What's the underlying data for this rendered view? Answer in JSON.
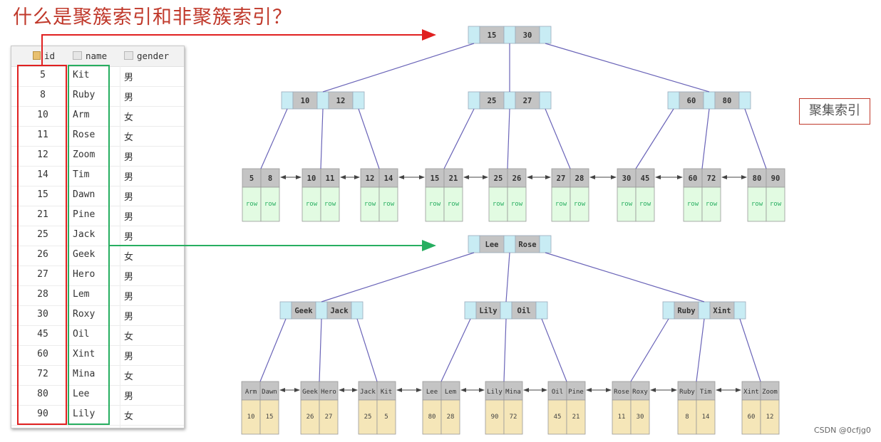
{
  "title": "什么是聚簇索引和非聚簇索引？",
  "table": {
    "columns": [
      {
        "label": "id",
        "icon": "primary-key-column-icon"
      },
      {
        "label": "name",
        "icon": "column-icon"
      },
      {
        "label": "gender",
        "icon": "column-icon"
      }
    ],
    "rows": [
      {
        "id": "5",
        "name": "Kit",
        "gender": "男"
      },
      {
        "id": "8",
        "name": "Ruby",
        "gender": "男"
      },
      {
        "id": "10",
        "name": "Arm",
        "gender": "女"
      },
      {
        "id": "11",
        "name": "Rose",
        "gender": "女"
      },
      {
        "id": "12",
        "name": "Zoom",
        "gender": "男"
      },
      {
        "id": "14",
        "name": "Tim",
        "gender": "男"
      },
      {
        "id": "15",
        "name": "Dawn",
        "gender": "男"
      },
      {
        "id": "21",
        "name": "Pine",
        "gender": "男"
      },
      {
        "id": "25",
        "name": "Jack",
        "gender": "男"
      },
      {
        "id": "26",
        "name": "Geek",
        "gender": "女"
      },
      {
        "id": "27",
        "name": "Hero",
        "gender": "男"
      },
      {
        "id": "28",
        "name": "Lem",
        "gender": "男"
      },
      {
        "id": "30",
        "name": "Roxy",
        "gender": "男"
      },
      {
        "id": "45",
        "name": "Oil",
        "gender": "女"
      },
      {
        "id": "60",
        "name": "Xint",
        "gender": "男"
      },
      {
        "id": "72",
        "name": "Mina",
        "gender": "女"
      },
      {
        "id": "80",
        "name": "Lee",
        "gender": "男"
      },
      {
        "id": "90",
        "name": "Lily",
        "gender": "女"
      }
    ]
  },
  "clustered_label": "聚集索引",
  "colors": {
    "title": "#c0392b",
    "id_highlight": "#e02020",
    "name_highlight": "#27ae60",
    "pointer_cell": "#c8ecf4",
    "key_cell": "#c4c4c4",
    "row_leaf": "#e2fbe2",
    "value_leaf": "#f5e6b8",
    "edge": "#6a64b8"
  },
  "clustered_tree": {
    "root": [
      "15",
      "30"
    ],
    "internal": [
      [
        "10",
        "12"
      ],
      [
        "25",
        "27"
      ],
      [
        "60",
        "80"
      ]
    ],
    "leaves": [
      {
        "keys": [
          "5",
          "8"
        ],
        "data": [
          "row",
          "row"
        ]
      },
      {
        "keys": [
          "10",
          "11"
        ],
        "data": [
          "row",
          "row"
        ]
      },
      {
        "keys": [
          "12",
          "14"
        ],
        "data": [
          "row",
          "row"
        ]
      },
      {
        "keys": [
          "15",
          "21"
        ],
        "data": [
          "row",
          "row"
        ]
      },
      {
        "keys": [
          "25",
          "26"
        ],
        "data": [
          "row",
          "row"
        ]
      },
      {
        "keys": [
          "27",
          "28"
        ],
        "data": [
          "row",
          "row"
        ]
      },
      {
        "keys": [
          "30",
          "45"
        ],
        "data": [
          "row",
          "row"
        ]
      },
      {
        "keys": [
          "60",
          "72"
        ],
        "data": [
          "row",
          "row"
        ]
      },
      {
        "keys": [
          "80",
          "90"
        ],
        "data": [
          "row",
          "row"
        ]
      }
    ]
  },
  "secondary_tree": {
    "root": [
      "Lee",
      "Rose"
    ],
    "internal": [
      [
        "Geek",
        "Jack"
      ],
      [
        "Lily",
        "Oil"
      ],
      [
        "Ruby",
        "Xint"
      ]
    ],
    "leaves": [
      {
        "keys": [
          "Arm",
          "Dawn"
        ],
        "data": [
          "10",
          "15"
        ]
      },
      {
        "keys": [
          "Geek",
          "Hero"
        ],
        "data": [
          "26",
          "27"
        ]
      },
      {
        "keys": [
          "Jack",
          "Kit"
        ],
        "data": [
          "25",
          "5"
        ]
      },
      {
        "keys": [
          "Lee",
          "Lem"
        ],
        "data": [
          "80",
          "28"
        ]
      },
      {
        "keys": [
          "Lily",
          "Mina"
        ],
        "data": [
          "90",
          "72"
        ]
      },
      {
        "keys": [
          "Oil",
          "Pine"
        ],
        "data": [
          "45",
          "21"
        ]
      },
      {
        "keys": [
          "Rose",
          "Roxy"
        ],
        "data": [
          "11",
          "30"
        ]
      },
      {
        "keys": [
          "Ruby",
          "Tim"
        ],
        "data": [
          "8",
          "14"
        ]
      },
      {
        "keys": [
          "Xint",
          "Zoom"
        ],
        "data": [
          "60",
          "12"
        ]
      }
    ]
  },
  "watermark": "CSDN @0cfjg0"
}
